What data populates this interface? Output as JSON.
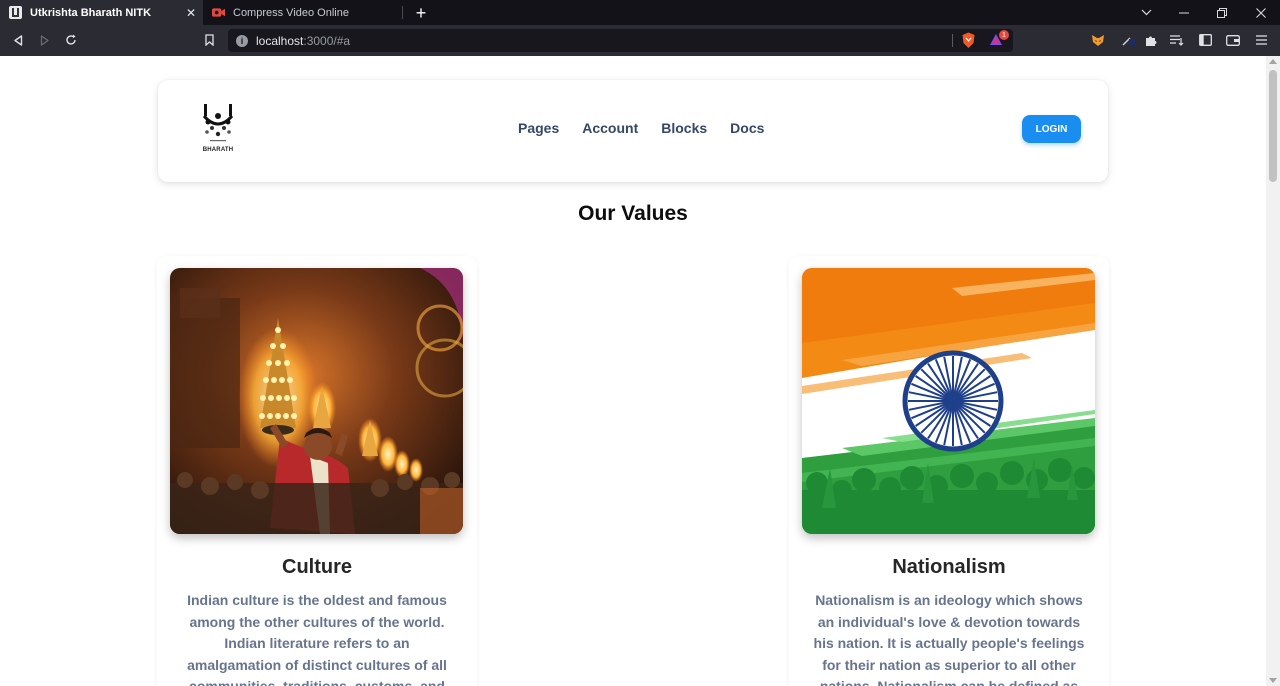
{
  "browser": {
    "tabs": [
      {
        "title": "Utkrishta Bharath NITK",
        "active": true,
        "icon": "site-logo-icon"
      },
      {
        "title": "Compress Video Online",
        "active": false,
        "icon": "video-camera-icon"
      }
    ],
    "url": {
      "host": "localhost",
      "rest": ":3000/#a"
    },
    "shield_badge": "1"
  },
  "navbar": {
    "logo_text": "BHARATH",
    "links": [
      "Pages",
      "Account",
      "Blocks",
      "Docs"
    ],
    "login_label": "LOGIN",
    "accent": "#1a8df1"
  },
  "values": {
    "title": "Our Values",
    "cards": [
      {
        "title": "Culture",
        "text": "Indian culture is the oldest and famous among the other cultures of the world. Indian literature refers to an amalgamation of distinct cultures of all communities, traditions, customs, and religions in India."
      },
      {
        "title": "Nationalism",
        "text": "Nationalism is an ideology which shows an individual's love & devotion towards his nation. It is actually people's feelings for their nation as superior to all other nations. Nationalism can be defined as collective"
      }
    ]
  }
}
